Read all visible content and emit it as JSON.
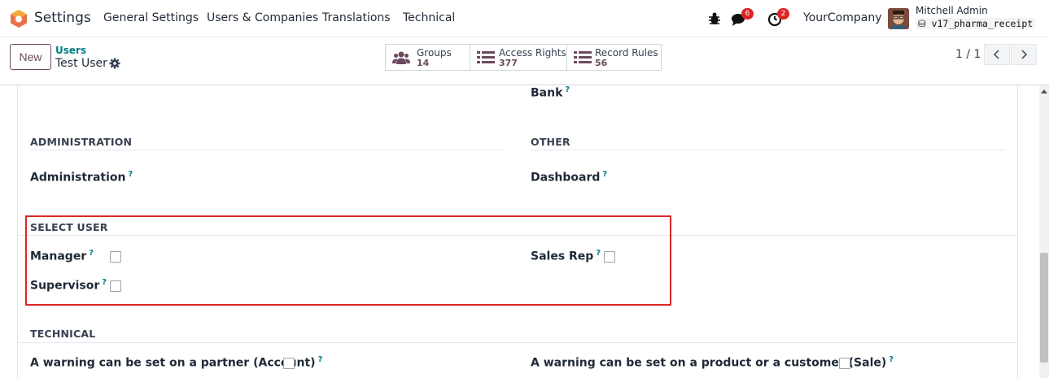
{
  "navbar": {
    "app_name": "Settings",
    "menus": [
      "General Settings",
      "Users & Companies",
      "Translations",
      "Technical"
    ],
    "messages_count": "6",
    "activities_count": "2",
    "company": "YourCompany",
    "user_name": "Mitchell Admin",
    "database": "v17_pharma_receipt"
  },
  "control": {
    "new_label": "New",
    "breadcrumb": "Users",
    "record_name": "Test User",
    "smart_buttons": [
      {
        "label": "Groups",
        "value": "14",
        "icon": "users-icon"
      },
      {
        "label": "Access Rights",
        "value": "377",
        "icon": "list-icon"
      },
      {
        "label": "Record Rules",
        "value": "56",
        "icon": "list-icon"
      }
    ],
    "pager": "1 / 1"
  },
  "form": {
    "bank_label": "Bank",
    "admin_section": "ADMINISTRATION",
    "admin_field": "Administration",
    "other_section": "OTHER",
    "dashboard_field": "Dashboard",
    "select_user_section": "SELECT USER",
    "manager_field": "Manager",
    "supervisor_field": "Supervisor",
    "sales_rep_field": "Sales Rep",
    "technical_section": "TECHNICAL",
    "warning_partner": "A warning can be set on a partner (Account)",
    "warning_product": "A warning can be set on a product or a customer (Sale)",
    "help_mark": "?"
  },
  "colors": {
    "accent": "#6b4a5f",
    "link": "#017e84",
    "badge": "#dc2626",
    "highlight": "#dc2626"
  }
}
